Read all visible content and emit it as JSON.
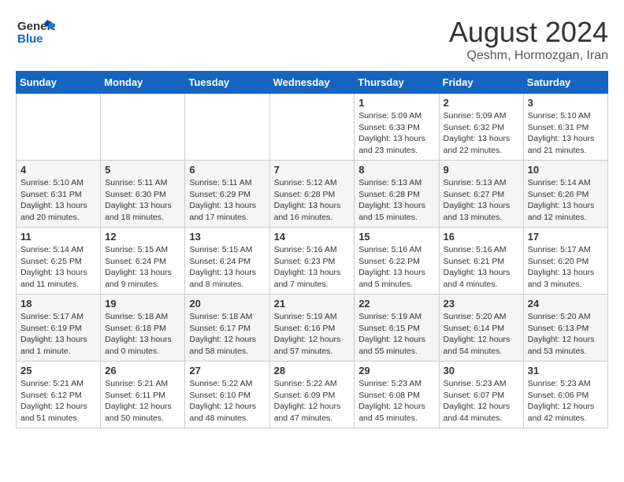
{
  "header": {
    "logo_general": "General",
    "logo_blue": "Blue",
    "month_title": "August 2024",
    "location": "Qeshm, Hormozgan, Iran"
  },
  "days_of_week": [
    "Sunday",
    "Monday",
    "Tuesday",
    "Wednesday",
    "Thursday",
    "Friday",
    "Saturday"
  ],
  "weeks": [
    [
      {
        "day": "",
        "info": ""
      },
      {
        "day": "",
        "info": ""
      },
      {
        "day": "",
        "info": ""
      },
      {
        "day": "",
        "info": ""
      },
      {
        "day": "1",
        "info": "Sunrise: 5:09 AM\nSunset: 6:33 PM\nDaylight: 13 hours and 23 minutes."
      },
      {
        "day": "2",
        "info": "Sunrise: 5:09 AM\nSunset: 6:32 PM\nDaylight: 13 hours and 22 minutes."
      },
      {
        "day": "3",
        "info": "Sunrise: 5:10 AM\nSunset: 6:31 PM\nDaylight: 13 hours and 21 minutes."
      }
    ],
    [
      {
        "day": "4",
        "info": "Sunrise: 5:10 AM\nSunset: 6:31 PM\nDaylight: 13 hours and 20 minutes."
      },
      {
        "day": "5",
        "info": "Sunrise: 5:11 AM\nSunset: 6:30 PM\nDaylight: 13 hours and 18 minutes."
      },
      {
        "day": "6",
        "info": "Sunrise: 5:11 AM\nSunset: 6:29 PM\nDaylight: 13 hours and 17 minutes."
      },
      {
        "day": "7",
        "info": "Sunrise: 5:12 AM\nSunset: 6:28 PM\nDaylight: 13 hours and 16 minutes."
      },
      {
        "day": "8",
        "info": "Sunrise: 5:13 AM\nSunset: 6:28 PM\nDaylight: 13 hours and 15 minutes."
      },
      {
        "day": "9",
        "info": "Sunrise: 5:13 AM\nSunset: 6:27 PM\nDaylight: 13 hours and 13 minutes."
      },
      {
        "day": "10",
        "info": "Sunrise: 5:14 AM\nSunset: 6:26 PM\nDaylight: 13 hours and 12 minutes."
      }
    ],
    [
      {
        "day": "11",
        "info": "Sunrise: 5:14 AM\nSunset: 6:25 PM\nDaylight: 13 hours and 11 minutes."
      },
      {
        "day": "12",
        "info": "Sunrise: 5:15 AM\nSunset: 6:24 PM\nDaylight: 13 hours and 9 minutes."
      },
      {
        "day": "13",
        "info": "Sunrise: 5:15 AM\nSunset: 6:24 PM\nDaylight: 13 hours and 8 minutes."
      },
      {
        "day": "14",
        "info": "Sunrise: 5:16 AM\nSunset: 6:23 PM\nDaylight: 13 hours and 7 minutes."
      },
      {
        "day": "15",
        "info": "Sunrise: 5:16 AM\nSunset: 6:22 PM\nDaylight: 13 hours and 5 minutes."
      },
      {
        "day": "16",
        "info": "Sunrise: 5:16 AM\nSunset: 6:21 PM\nDaylight: 13 hours and 4 minutes."
      },
      {
        "day": "17",
        "info": "Sunrise: 5:17 AM\nSunset: 6:20 PM\nDaylight: 13 hours and 3 minutes."
      }
    ],
    [
      {
        "day": "18",
        "info": "Sunrise: 5:17 AM\nSunset: 6:19 PM\nDaylight: 13 hours and 1 minute."
      },
      {
        "day": "19",
        "info": "Sunrise: 5:18 AM\nSunset: 6:18 PM\nDaylight: 13 hours and 0 minutes."
      },
      {
        "day": "20",
        "info": "Sunrise: 5:18 AM\nSunset: 6:17 PM\nDaylight: 12 hours and 58 minutes."
      },
      {
        "day": "21",
        "info": "Sunrise: 5:19 AM\nSunset: 6:16 PM\nDaylight: 12 hours and 57 minutes."
      },
      {
        "day": "22",
        "info": "Sunrise: 5:19 AM\nSunset: 6:15 PM\nDaylight: 12 hours and 55 minutes."
      },
      {
        "day": "23",
        "info": "Sunrise: 5:20 AM\nSunset: 6:14 PM\nDaylight: 12 hours and 54 minutes."
      },
      {
        "day": "24",
        "info": "Sunrise: 5:20 AM\nSunset: 6:13 PM\nDaylight: 12 hours and 53 minutes."
      }
    ],
    [
      {
        "day": "25",
        "info": "Sunrise: 5:21 AM\nSunset: 6:12 PM\nDaylight: 12 hours and 51 minutes."
      },
      {
        "day": "26",
        "info": "Sunrise: 5:21 AM\nSunset: 6:11 PM\nDaylight: 12 hours and 50 minutes."
      },
      {
        "day": "27",
        "info": "Sunrise: 5:22 AM\nSunset: 6:10 PM\nDaylight: 12 hours and 48 minutes."
      },
      {
        "day": "28",
        "info": "Sunrise: 5:22 AM\nSunset: 6:09 PM\nDaylight: 12 hours and 47 minutes."
      },
      {
        "day": "29",
        "info": "Sunrise: 5:23 AM\nSunset: 6:08 PM\nDaylight: 12 hours and 45 minutes."
      },
      {
        "day": "30",
        "info": "Sunrise: 5:23 AM\nSunset: 6:07 PM\nDaylight: 12 hours and 44 minutes."
      },
      {
        "day": "31",
        "info": "Sunrise: 5:23 AM\nSunset: 6:06 PM\nDaylight: 12 hours and 42 minutes."
      }
    ]
  ]
}
